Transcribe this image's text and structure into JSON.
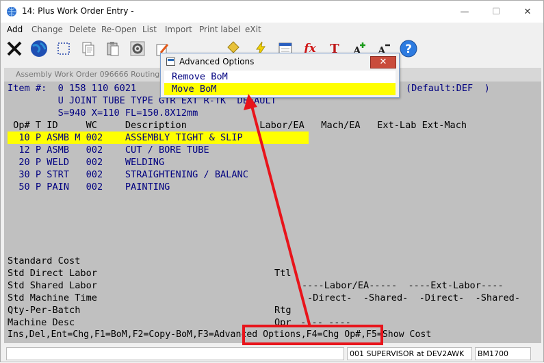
{
  "window": {
    "title": "14: Plus Work Order Entry -",
    "min_glyph": "—",
    "max_glyph": "☐",
    "close_glyph": "✕"
  },
  "menu": [
    "Add",
    "Change",
    "Delete",
    "Re-Open",
    "List",
    "Import",
    "Print label",
    "eXit"
  ],
  "toolbar": {
    "icons": [
      "exit-icon",
      "globe-icon",
      "select-icon",
      "copy-icon",
      "paste-icon",
      "settings-icon",
      "edit-icon",
      "stamp-icon",
      "lightning-icon",
      "calendar-icon",
      "formula-icon",
      "text-format-icon",
      "add-text-icon",
      "subtract-text-icon",
      "help-icon"
    ],
    "fx_label": "fx",
    "tx_label": "T",
    "help_label": "?"
  },
  "inner_window": {
    "title": "Assembly Work Order 096666 Routing M"
  },
  "terminal": {
    "item_line": "Item #:  0 158 110 6021",
    "default_text": "(Default:DEF  )",
    "desc_line1": "         U JOINT TUBE TYPE GTR EXT R-TK  DEFAULT",
    "desc_line2": "         S=940 X=110 FL=150.8X12mm",
    "header": " Op# T ID     WC     Description             Labor/EA   Mach/EA   Ext-Lab Ext-Mach",
    "rows": [
      "  10 P ASMB M 002    ASSEMBLY TIGHT & SLIP",
      "  12 P ASMB   002    CUT / BORE TUBE",
      "  20 P WELD   002    WELDING",
      "  30 P STRT   002    STRAIGHTENING / BALANC",
      "  50 P PAIN   002    PAINTING"
    ],
    "standard_cost": "Standard Cost",
    "std_direct_labor": "Std Direct Labor",
    "ttl": "Ttl",
    "std_shared_labor": "Std Shared Labor",
    "labor_ea_header": "----Labor/EA-----  ----Ext-Labor----",
    "std_machine_time": "Std Machine Time",
    "direct_shared_header": "-Direct-  -Shared-  -Direct-  -Shared-",
    "qty_per_batch": "Qty-Per-Batch",
    "rtg": "Rtg",
    "machine_desc": "Machine Desc",
    "opr": "Opr",
    "opr_value": " ---- ----",
    "function_keys": "Ins,Del,Ent=Chg,F1=BoM,F2=Copy-BoM,F3=Advanced Options,F4=Chg Op#,F5=Show Cost"
  },
  "popup": {
    "title": "Advanced Options",
    "close_glyph": "✕",
    "items": [
      "Remove BoM",
      "Move BoM"
    ]
  },
  "status": {
    "user": "001 SUPERVISOR at DEV2AWK",
    "code": "BM1700"
  },
  "colors": {
    "highlight": "#ffff00",
    "annotation_red": "#e8141b",
    "terminal_bg": "#c0c0c0",
    "terminal_text_blue": "#000080"
  }
}
